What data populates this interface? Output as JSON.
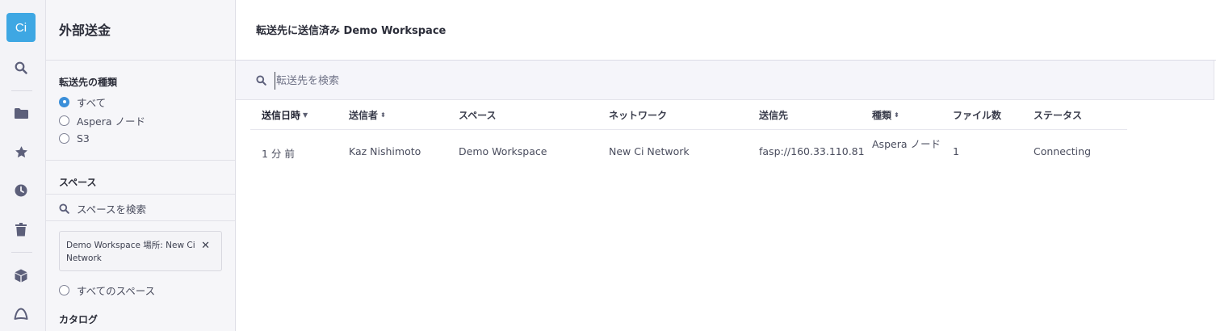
{
  "rail": {
    "logo_text": "Ci",
    "icons": [
      "search-icon",
      "folder-icon",
      "star-icon",
      "clock-icon",
      "trash-icon",
      "cube-icon",
      "dome-icon"
    ]
  },
  "panel": {
    "title": "外部送金",
    "transfer_type": {
      "title": "転送先の種類",
      "options": [
        "すべて",
        "Aspera ノード",
        "S3"
      ],
      "selected": "すべて"
    },
    "spaces": {
      "title": "スペース",
      "search_placeholder": "スペースを検索",
      "selected_tag": "Demo Workspace 場所: New Ci Network",
      "all_spaces_label": "すべてのスペース"
    },
    "catalog_title": "カタログ"
  },
  "main": {
    "title": "転送先に送信済み Demo Workspace",
    "search_placeholder": "転送先を検索",
    "columns": [
      "送信日時",
      "送信者",
      "スペース",
      "ネットワーク",
      "送信先",
      "種類",
      "ファイル数",
      "ステータス"
    ],
    "rows": [
      {
        "sent_at": "1 分 前",
        "sender": "Kaz Nishimoto",
        "space": "Demo Workspace",
        "network": "New Ci Network",
        "destination": "fasp://160.33.110.81",
        "type": "Aspera ノード",
        "file_count": "1",
        "status": "Connecting"
      }
    ]
  },
  "colors": {
    "accent": "#3ea7e3",
    "radio_checked": "#3b8fd9",
    "rail_icon": "#5c5f7a"
  }
}
